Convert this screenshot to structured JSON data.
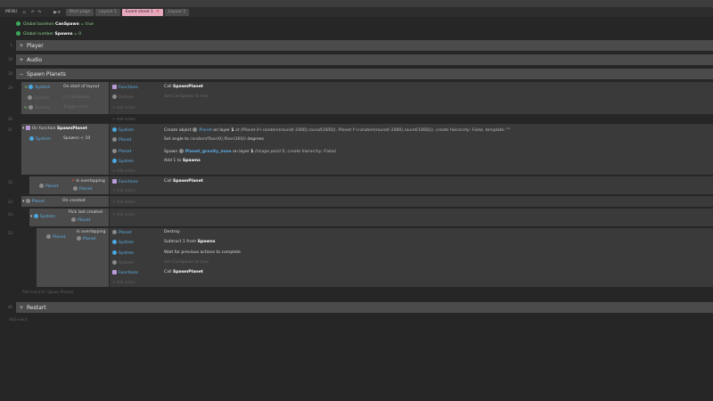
{
  "toolbar": {
    "menu_label": "MENU",
    "undo_icon": "undo-icon",
    "redo_icon": "redo-icon",
    "play_icon": "play-icon",
    "tabs": [
      {
        "label": "Start page",
        "active": false
      },
      {
        "label": "Layout 1",
        "active": false
      },
      {
        "label": "Event sheet 1",
        "active": true,
        "close": "✕"
      },
      {
        "label": "Layout 2",
        "active": false
      }
    ]
  },
  "globals": [
    {
      "prefix": "Global boolean ",
      "name": "CanSpawn",
      "suffix": " = true"
    },
    {
      "prefix": "Global number ",
      "name": "Spawns",
      "suffix": " = 0"
    }
  ],
  "groups": {
    "player": {
      "line": "1",
      "title": "Player"
    },
    "audio": {
      "line": "10",
      "title": "Audio"
    },
    "spawn": {
      "line": "18",
      "title": "Spawn Planets"
    },
    "restart": {
      "line": "46",
      "title": "Restart"
    }
  },
  "events": {
    "e19": {
      "line": "19",
      "conditions": [
        {
          "object": "System",
          "text": "On start of layout"
        },
        {
          "object": "System",
          "text": "Is CanSpawn"
        },
        {
          "object": "System",
          "text": "Trigger once"
        }
      ],
      "actions": [
        {
          "object": "Functions",
          "text": "Call ",
          "bold": "SpawnPlanet"
        },
        {
          "object": "System",
          "text": "Set CanSpawn to true"
        }
      ],
      "add_action": "Add action"
    },
    "e30": {
      "line": "30",
      "add_action": "Add action"
    },
    "e31": {
      "line": "31",
      "function_label": "On function ",
      "function_name": "SpawnPlanet",
      "condition": {
        "object": "System",
        "text": "Spawns < 10"
      },
      "actions": [
        {
          "object": "System",
          "pre": "Create object ",
          "obj": "Planet",
          "text": " on layer ",
          "bold": "1",
          "rest": " at (Planet.X+random(round(-1000),round(1000)), Planet.Y+random(round(-1000),round(1000))), create hierarchy: False, template: \"\""
        },
        {
          "object": "Planet",
          "text": "Set angle to ",
          "ital": "random(floor(0),floor(360))",
          "rest": " degrees"
        },
        {
          "object": "Planet",
          "pre": "Spawn ",
          "obj": "Planet_gravity_zone",
          "text": " on layer ",
          "bold": "1",
          "rest": " (image point 0, create hierarchy: False)"
        },
        {
          "object": "System",
          "text": "Add 1 to ",
          "bold": "Spawns"
        }
      ],
      "add_action": "Add action"
    },
    "e32": {
      "line": "32",
      "condition": {
        "object": "Planet",
        "text": "Is overlapping",
        "target": "Planet"
      },
      "actions": [
        {
          "object": "Functions",
          "text": "Call ",
          "bold": "SpawnPlanet"
        }
      ],
      "add_action": "Add action"
    },
    "e33": {
      "line": "33",
      "condition": {
        "object": "Planet",
        "text": "On created"
      },
      "add_action": "Add action"
    },
    "e34": {
      "line": "34",
      "condition": {
        "object": "System",
        "text": "Pick last created",
        "target": "Planet"
      },
      "add_action": "Add action"
    },
    "e35": {
      "line": "35",
      "condition": {
        "object": "Planet",
        "text": "Is overlapping",
        "target": "Planet"
      },
      "actions": [
        {
          "object": "Planet",
          "text": "Destroy"
        },
        {
          "object": "System",
          "text": "Subtract 1 from ",
          "bold": "Spawns"
        },
        {
          "object": "System",
          "text": "Wait for previous actions to complete"
        },
        {
          "object": "System",
          "text": "Set CanSpawn to true"
        },
        {
          "object": "Functions",
          "text": "Call ",
          "bold": "SpawnPlanet"
        }
      ],
      "add_action": "Add action"
    }
  },
  "add_event_to_group": "Add event to 'Spawn Planets'",
  "add_event": "Add event",
  "colors": {
    "accent_tab": "#e6a8bb",
    "global_icon": "#3ea85b",
    "system_icon": "#4aa8e0",
    "object_text": "#5db0e6"
  }
}
